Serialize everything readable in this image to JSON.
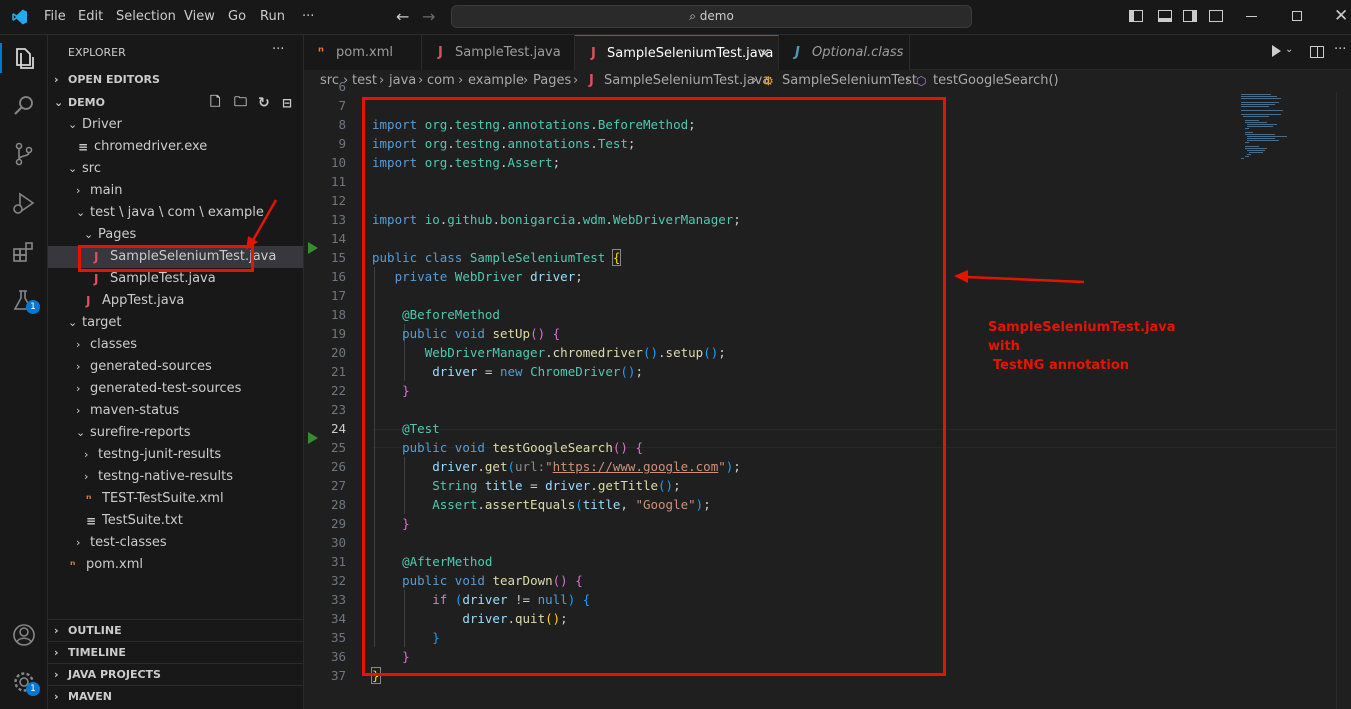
{
  "titlebar": {
    "menus": [
      "File",
      "Edit",
      "Selection",
      "View",
      "Go",
      "Run",
      "···"
    ],
    "search": "demo"
  },
  "activitybar": {
    "icons": [
      "explorer-icon",
      "search-icon",
      "source-control-icon",
      "run-debug-icon",
      "extensions-icon",
      "testing-icon",
      "accounts-icon",
      "manage-icon"
    ],
    "testing_badge": "1",
    "manage_badge": "1"
  },
  "sidebar": {
    "title": "EXPLORER",
    "more": "···",
    "open_editors": "OPEN EDITORS",
    "project": "DEMO",
    "tree": [
      {
        "label": "Driver",
        "depth": 1,
        "chev": "⌄",
        "icon": ""
      },
      {
        "label": "chromedriver.exe",
        "depth": 2,
        "chev": "",
        "icon": "≡"
      },
      {
        "label": "src",
        "depth": 1,
        "chev": "⌄",
        "icon": ""
      },
      {
        "label": "main",
        "depth": 2,
        "chev": "›",
        "icon": ""
      },
      {
        "label": "test \\ java \\ com \\ example",
        "depth": 2,
        "chev": "⌄",
        "icon": ""
      },
      {
        "label": "Pages",
        "depth": 3,
        "chev": "⌄",
        "icon": ""
      },
      {
        "label": "SampleSeleniumTest.java",
        "depth": 4,
        "chev": "",
        "icon": "J"
      },
      {
        "label": "SampleTest.java",
        "depth": 4,
        "chev": "",
        "icon": "J"
      },
      {
        "label": "AppTest.java",
        "depth": 3,
        "chev": "",
        "icon": "J"
      },
      {
        "label": "target",
        "depth": 1,
        "chev": "⌄",
        "icon": ""
      },
      {
        "label": "classes",
        "depth": 2,
        "chev": "›",
        "icon": ""
      },
      {
        "label": "generated-sources",
        "depth": 2,
        "chev": "›",
        "icon": ""
      },
      {
        "label": "generated-test-sources",
        "depth": 2,
        "chev": "›",
        "icon": ""
      },
      {
        "label": "maven-status",
        "depth": 2,
        "chev": "›",
        "icon": ""
      },
      {
        "label": "surefire-reports",
        "depth": 2,
        "chev": "⌄",
        "icon": ""
      },
      {
        "label": "testng-junit-results",
        "depth": 3,
        "chev": "›",
        "icon": ""
      },
      {
        "label": "testng-native-results",
        "depth": 3,
        "chev": "›",
        "icon": ""
      },
      {
        "label": "TEST-TestSuite.xml",
        "depth": 3,
        "chev": "",
        "icon": "ⁿ"
      },
      {
        "label": "TestSuite.txt",
        "depth": 3,
        "chev": "",
        "icon": "≡"
      },
      {
        "label": "test-classes",
        "depth": 2,
        "chev": "›",
        "icon": ""
      },
      {
        "label": "pom.xml",
        "depth": 1,
        "chev": "",
        "icon": "ⁿ"
      }
    ],
    "sections": [
      "OUTLINE",
      "TIMELINE",
      "JAVA PROJECTS",
      "MAVEN"
    ]
  },
  "tabs": [
    {
      "label": "pom.xml",
      "icon": "ⁿ",
      "icon_color": "#e37933"
    },
    {
      "label": "SampleTest.java",
      "icon": "J",
      "icon_color": "#e04f5f"
    },
    {
      "label": "SampleSeleniumTest.java",
      "icon": "J",
      "icon_color": "#e04f5f",
      "close": "×"
    },
    {
      "label": "Optional.class",
      "icon": "J",
      "icon_color": "#519aba"
    }
  ],
  "breadcrumb": [
    "src",
    "test",
    "java",
    "com",
    "example",
    "Pages",
    "SampleSeleniumTest.java",
    "SampleSeleniumTest",
    "testGoogleSearch()"
  ],
  "editor": {
    "line_numbers": [
      "6",
      "7",
      "8",
      "9",
      "10",
      "11",
      "12",
      "13",
      "14",
      "15",
      "16",
      "17",
      "18",
      "19",
      "20",
      "21",
      "22",
      "23",
      "24",
      "25",
      "26",
      "27",
      "28",
      "29",
      "30",
      "31",
      "32",
      "33",
      "34",
      "35",
      "36",
      "37"
    ],
    "url": "https://www.google.com",
    "url_hint": "url:",
    "google": "\"Google\""
  },
  "annotation": {
    "line1": "SampleSeleniumTest.java with",
    "line2": "TestNG annotation"
  }
}
